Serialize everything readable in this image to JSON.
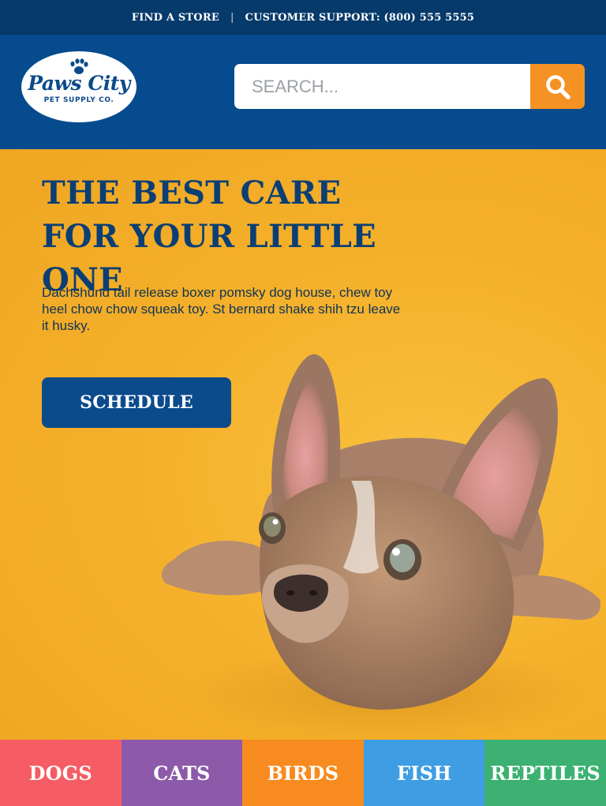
{
  "topbar": {
    "find_store": "FIND A STORE",
    "separator": "|",
    "support": "CUSTOMER SUPPORT: (800) 555 5555"
  },
  "header": {
    "logo": {
      "main": "Paws City",
      "sub": "PET SUPPLY CO.",
      "icon": "paw-icon"
    },
    "search": {
      "placeholder": "SEARCH...",
      "value": "",
      "icon": "search-icon"
    }
  },
  "hero": {
    "title": "THE BEST CARE FOR YOUR LITTLE ONE",
    "body": "Dachshund tail release boxer pomsky dog house, chew toy heel chow chow squeak toy. St bernard shake shih tzu leave it husky.",
    "cta": "SCHEDULE",
    "image": "french-bulldog-puppy"
  },
  "categories": [
    {
      "label": "DOGS",
      "color": "#f65c63"
    },
    {
      "label": "CATS",
      "color": "#8c5aa8"
    },
    {
      "label": "BIRDS",
      "color": "#f78b1f"
    },
    {
      "label": "FISH",
      "color": "#3f9de3"
    },
    {
      "label": "REPTILES",
      "color": "#3cb171"
    }
  ],
  "colors": {
    "topbar": "#063a6b",
    "header": "#054b8e",
    "hero_bg": "#f5b12b",
    "accent": "#f59224",
    "primary": "#0b4b8c"
  }
}
